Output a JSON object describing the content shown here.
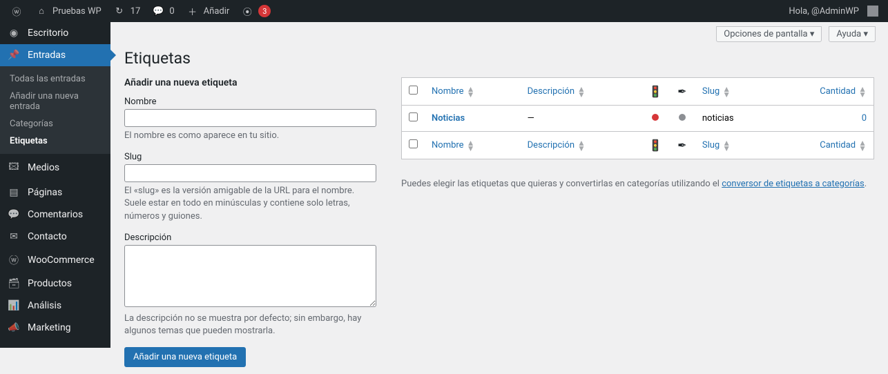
{
  "adminbar": {
    "site_name": "Pruebas WP",
    "revisions": "17",
    "comments": "0",
    "add_new": "Añadir",
    "yoast_count": "3",
    "greeting": "Hola, @AdminWP"
  },
  "menu": {
    "dashboard": "Escritorio",
    "posts": "Entradas",
    "posts_sub": {
      "all": "Todas las entradas",
      "add": "Añadir una nueva entrada",
      "categories": "Categorías",
      "tags": "Etiquetas"
    },
    "media": "Medios",
    "pages": "Páginas",
    "comments": "Comentarios",
    "contact": "Contacto",
    "woocommerce": "WooCommerce",
    "products": "Productos",
    "analytics": "Análisis",
    "marketing": "Marketing"
  },
  "screen": {
    "options": "Opciones de pantalla ▾",
    "help": "Ayuda ▾"
  },
  "page": {
    "title": "Etiquetas",
    "form_title": "Añadir una nueva etiqueta"
  },
  "form": {
    "name_label": "Nombre",
    "name_help": "El nombre es como aparece en tu sitio.",
    "slug_label": "Slug",
    "slug_help": "El «slug» es la versión amigable de la URL para el nombre. Suele estar en todo en minúsculas y contiene solo letras, números y guiones.",
    "desc_label": "Descripción",
    "desc_help": "La descripción no se muestra por defecto; sin embargo, hay algunos temas que pueden mostrarla.",
    "submit": "Añadir una nueva etiqueta"
  },
  "table": {
    "cols": {
      "name": "Nombre",
      "description": "Descripción",
      "slug": "Slug",
      "count": "Cantidad"
    },
    "rows": [
      {
        "name": "Noticias",
        "description": "—",
        "slug": "noticias",
        "count": "0"
      }
    ]
  },
  "converter": {
    "prefix": "Puedes elegir las etiquetas que quieras y convertirlas en categorías utilizando el ",
    "link": "conversor de etiquetas a categorías",
    "suffix": "."
  }
}
